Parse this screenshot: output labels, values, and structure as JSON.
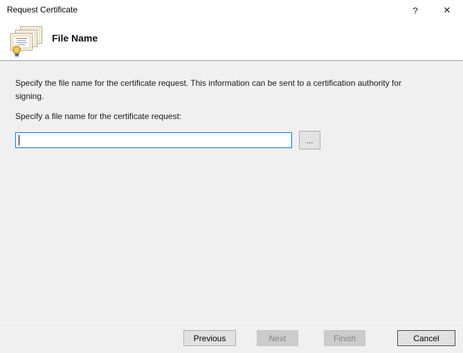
{
  "window": {
    "title": "Request Certificate",
    "help_label": "?",
    "close_label": "✕"
  },
  "header": {
    "title": "File Name",
    "icon": "certificates-icon"
  },
  "body": {
    "description": "Specify the file name for the certificate request. This information can be sent to a certification authority for signing.",
    "field_label": "Specify a file name for the certificate request:",
    "file_name_input": {
      "value": "",
      "placeholder": ""
    },
    "browse_label": "..."
  },
  "footer": {
    "buttons": [
      {
        "label": "Previous",
        "enabled": true
      },
      {
        "label": "Next",
        "enabled": false
      },
      {
        "label": "Finish",
        "enabled": false
      },
      {
        "label": "Cancel",
        "enabled": true
      }
    ]
  },
  "colors": {
    "accent": "#0078d7",
    "header_bg": "#ffffff",
    "body_bg": "#f0f0f0",
    "header_divider": "#9d9d9d",
    "button_bg": "#e1e1e1",
    "button_border": "#adadad",
    "button_disabled_bg": "#cccccc",
    "button_disabled_text": "#838383",
    "cancel_focus_border": "#474747",
    "certificate_paper": "#fbf7ee",
    "certificate_border": "#b9a47c",
    "seal_gold": "#e8b43a",
    "ribbon_blue": "#3f6ad0"
  }
}
